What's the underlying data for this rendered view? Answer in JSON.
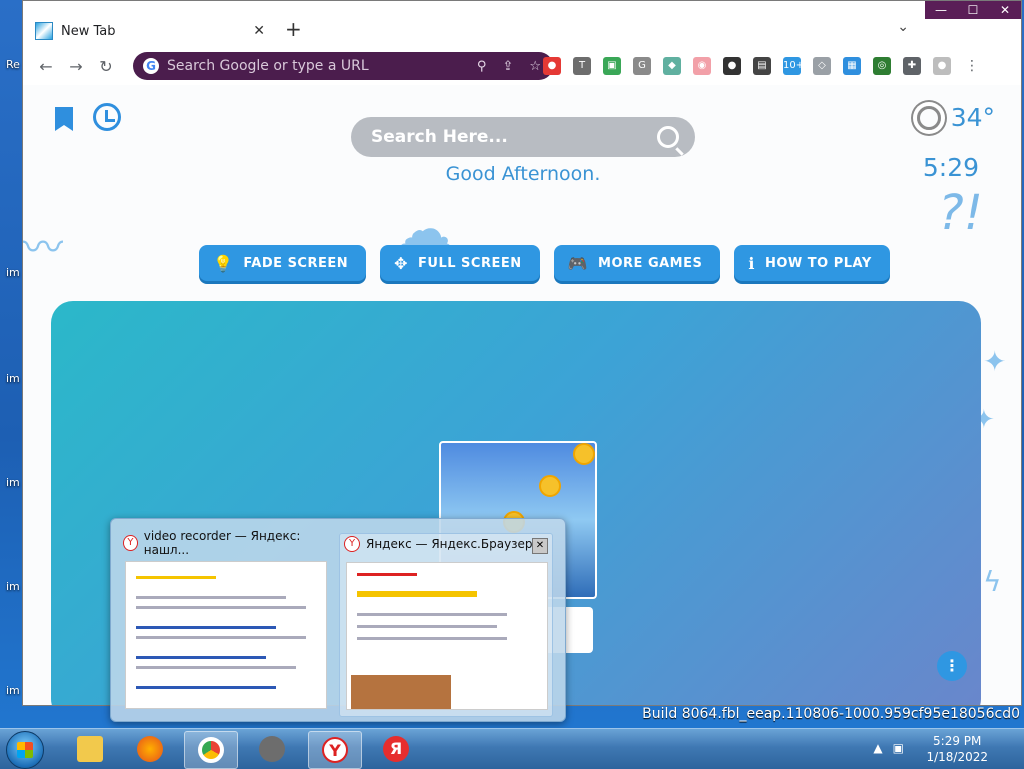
{
  "browser": {
    "tab_title": "New Tab",
    "tab_close": "✕",
    "new_tab": "+",
    "tab_menu": "⌄",
    "window_controls": {
      "minimize": "—",
      "maximize": "☐",
      "close": "✕"
    },
    "nav": {
      "back": "←",
      "forward": "→",
      "reload": "↻"
    },
    "omnibox_placeholder": "Search Google or type a URL",
    "omnibox_g": "G",
    "extensions": [
      {
        "name": "chat-extension-icon",
        "color": "#e53935",
        "text": "●"
      },
      {
        "name": "t-extension-icon",
        "color": "#6d6d6d",
        "text": "T"
      },
      {
        "name": "green-extension-icon",
        "color": "#3aa757",
        "text": "▣"
      },
      {
        "name": "g-extension-icon",
        "color": "#8a8a8a",
        "text": "G"
      },
      {
        "name": "cat-extension-icon",
        "color": "#60b0a0",
        "text": "◆"
      },
      {
        "name": "pig-extension-icon",
        "color": "#f2a0a8",
        "text": "◉"
      },
      {
        "name": "bubble-extension-icon",
        "color": "#333333",
        "text": "●"
      },
      {
        "name": "message-extension-icon",
        "color": "#444444",
        "text": "▤"
      },
      {
        "name": "badge-extension-icon",
        "color": "#2f97e2",
        "text": "10+"
      },
      {
        "name": "robot-extension-icon",
        "color": "#9aa0a6",
        "text": "◇"
      },
      {
        "name": "game-extension-icon",
        "color": "#2f8fde",
        "text": "▦"
      },
      {
        "name": "target-extension-icon",
        "color": "#2e7d32",
        "text": "◎"
      },
      {
        "name": "puzzle-extension-icon",
        "color": "#5f6368",
        "text": "✚"
      },
      {
        "name": "profile-icon",
        "color": "#bdbdbd",
        "text": "●"
      },
      {
        "name": "menu-dots-icon",
        "color": "#ffffff",
        "text": "⋮"
      }
    ]
  },
  "newtab": {
    "search_placeholder": "Search Here...",
    "greeting": "Good Afternoon.",
    "temperature": "34°",
    "time": "5:29",
    "buttons": [
      {
        "label": "FADE SCREEN",
        "icon": "💡"
      },
      {
        "label": "FULL SCREEN",
        "icon": "✥"
      },
      {
        "label": "MORE GAMES",
        "icon": "🎮"
      },
      {
        "label": "HOW TO PLAY",
        "icon": "ℹ"
      }
    ]
  },
  "desktop": {
    "labels": [
      "Re",
      "im",
      "im",
      "im",
      "im",
      "im"
    ],
    "build_text": "Build 8064.fbl_eeap.110806-1000.959cf95e18056cd0"
  },
  "preview": {
    "windows": [
      {
        "title": "video recorder — Яндекс: нашл...",
        "icon": "Y"
      },
      {
        "title": "Яндекс — Яндекс.Браузер",
        "icon": "Y",
        "close": "✕"
      }
    ]
  },
  "taskbar": {
    "time": "5:29 PM",
    "date": "1/18/2022",
    "tray_arrow": "▲"
  }
}
